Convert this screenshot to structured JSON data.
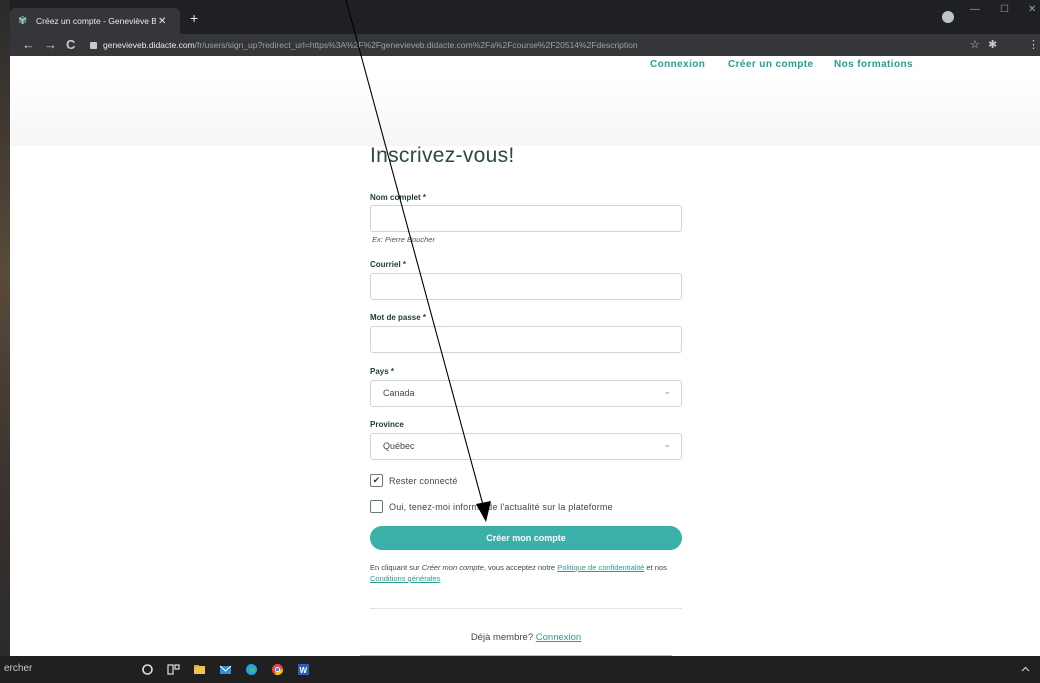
{
  "browser": {
    "tab_title": "Créez un compte - Geneviève Be",
    "tab_close": "✕",
    "new_tab": "+",
    "url_host": "genevieveb.didacte.com",
    "url_rest": "/fr/users/sign_up?redirect_url=https%3A%2F%2Fgenevieveb.didacte.com%2Fa%2Fcourse%2F20514%2Fdescription",
    "nav_back": "←",
    "nav_forward": "→",
    "nav_reload": "C",
    "star": "☆",
    "puzzle": "✱",
    "menu": "⋮",
    "win_min": "—",
    "win_max": "☐",
    "win_close": "✕"
  },
  "topnav": {
    "login": "Connexion",
    "signup": "Créer un compte",
    "courses": "Nos formations"
  },
  "form": {
    "title": "Inscrivez-vous!",
    "name_label": "Nom complet *",
    "name_hint": "Ex: Pierre Boucher",
    "email_label": "Courriel *",
    "password_label": "Mot de passe *",
    "country_label": "Pays *",
    "country_value": "Canada",
    "province_label": "Province",
    "province_value": "Québec",
    "stay_connected": "Rester connecté",
    "stay_connected_checked": true,
    "newsletter": "Oui, tenez-moi informé de l'actualité sur la plateforme",
    "newsletter_checked": false,
    "submit": "Créer mon compte",
    "legal_1": "En cliquant sur ",
    "legal_em": "Créer mon compte",
    "legal_2": ", vous acceptez notre ",
    "legal_privacy": "Politique de confidentialité",
    "legal_3": " et nos ",
    "legal_terms": "Conditions générales",
    "member_q": "Déjà membre? ",
    "member_link": "Connexion"
  },
  "taskbar": {
    "search": "ercher"
  },
  "colors": {
    "accent": "#3ab0a8",
    "link": "#2a9d8f",
    "title": "#2b4a4a"
  }
}
